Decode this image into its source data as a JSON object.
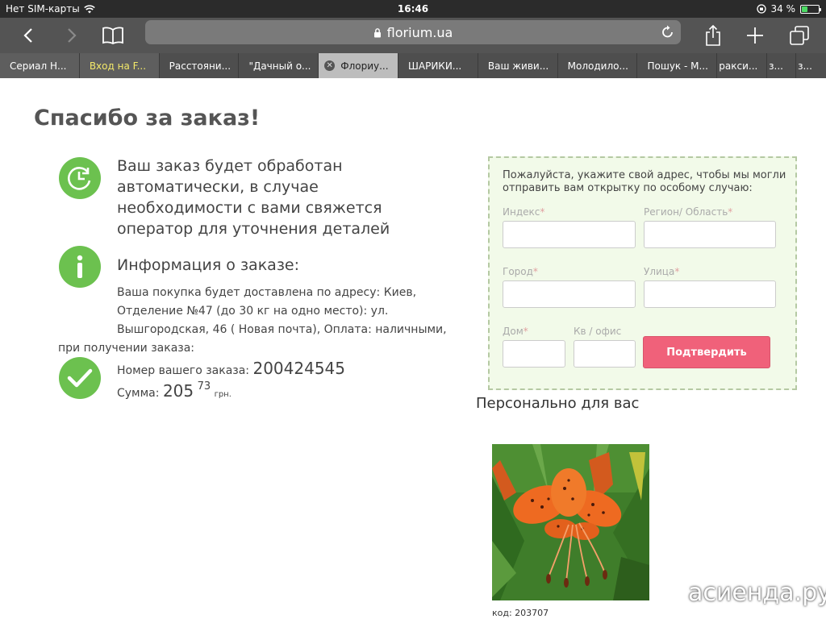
{
  "status": {
    "carrier": "Нет SIM-карты",
    "time": "16:46",
    "battery": "34 %",
    "battery_level": 0.34
  },
  "browser": {
    "url": "florium.ua",
    "tabs": [
      {
        "label": "Сериал Н..."
      },
      {
        "label": "Вход на F..."
      },
      {
        "label": "Расстояни..."
      },
      {
        "label": "\"Дачный о..."
      },
      {
        "label": "Флориу..."
      },
      {
        "label": "ШАРИКИ..."
      },
      {
        "label": "Ваш живи..."
      },
      {
        "label": "Молодило..."
      },
      {
        "label": "Пошук - М..."
      },
      {
        "label": "ракси..."
      },
      {
        "label": "з..."
      },
      {
        "label": "з..."
      }
    ]
  },
  "page": {
    "title": "Спасибо за заказ!",
    "processing_line1": "Ваш заказ будет обработан",
    "processing_line2": "автоматически, в случае",
    "processing_line3": "необходимости с вами свяжется",
    "processing_line4": "оператор для уточнения деталей",
    "info_heading": "Информация о заказе:",
    "delivery_line1": "Ваша покупка будет доставлена по адресу: Киев,",
    "delivery_line2": "Отделение №47 (до 30 кг на одно место): ул.",
    "delivery_line3": "Вышгородская, 46 ( Новая почта), Оплата: наличными,",
    "delivery_line4": "при получении заказа:",
    "order_number_label": "Номер вашего заказа:",
    "order_number": "200424545",
    "sum_label": "Сумма:",
    "sum_main": "205",
    "sum_cents": "73",
    "sum_currency": "грн."
  },
  "form": {
    "note": "Пожалуйста, укажите свой адрес, чтобы мы могли отправить вам открытку по особому случаю:",
    "index_label": "Индекс",
    "region_label": "Регион/ Область",
    "city_label": "Город",
    "street_label": "Улица",
    "house_label": "Дом",
    "apt_label": "Кв / офис",
    "required_mark": "*",
    "submit": "Подтвердить"
  },
  "recommend": {
    "heading": "Персонально для вас",
    "code": "код: 203707"
  },
  "watermark": "асиенда.ру"
}
